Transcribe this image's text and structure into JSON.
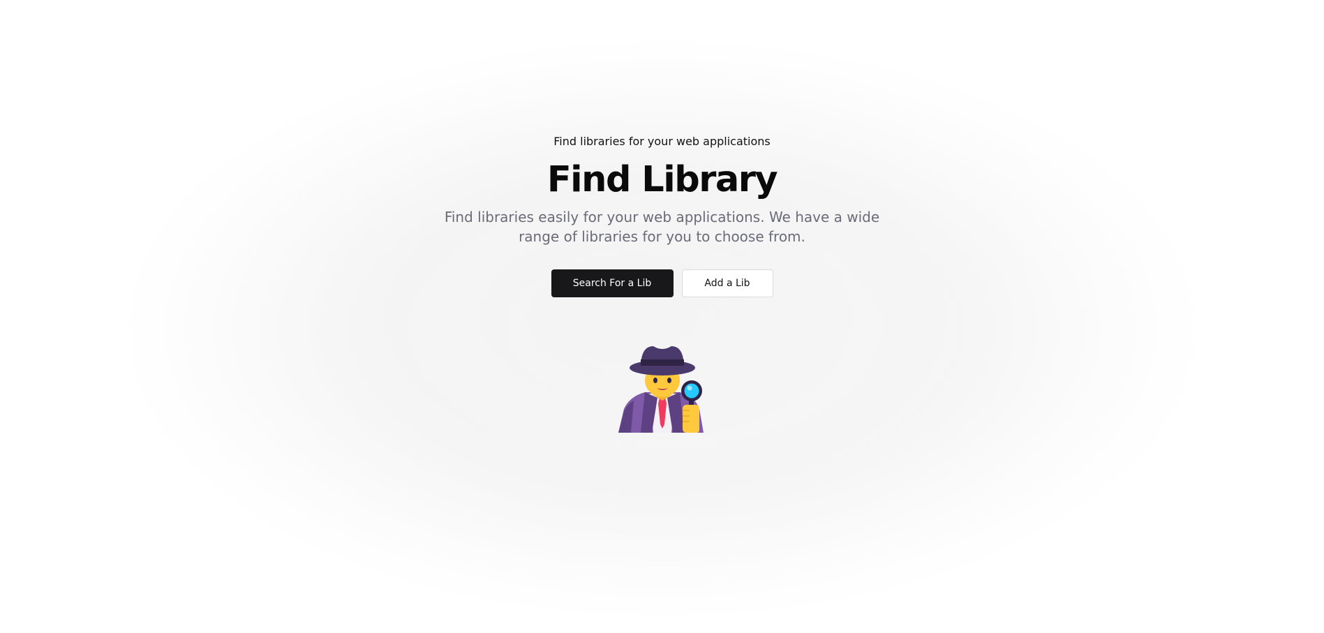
{
  "hero": {
    "eyebrow": "Find libraries for your web applications",
    "title": "Find Library",
    "description": "Find libraries easily for your web applications. We have a wide range of libraries for you to choose from.",
    "primary_button": "Search For a Lib",
    "secondary_button": "Add a Lib",
    "illustration_icon": "detective-emoji-icon"
  },
  "colors": {
    "primary_button_bg": "#18181b",
    "text_dark": "#0a0a0a",
    "text_muted": "#6b6b78",
    "hat": "#4a3a6b",
    "coat": "#7e5aa8",
    "skin": "#ffc83d",
    "magnifier_lens": "#26c9fc",
    "tie": "#f03a5f"
  }
}
